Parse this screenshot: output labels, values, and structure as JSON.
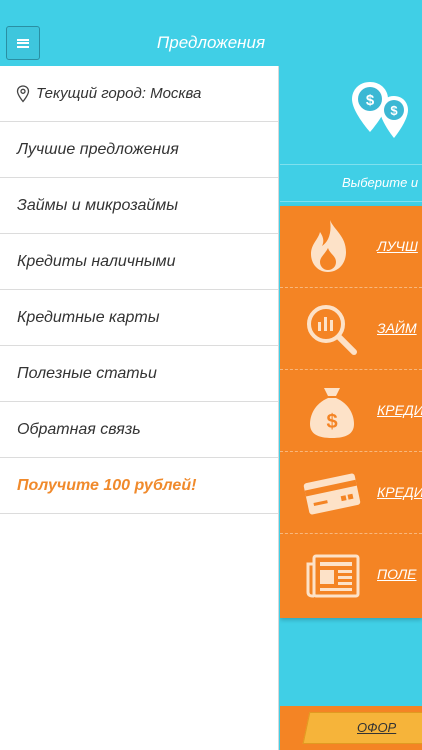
{
  "navbar": {
    "title": "Предложения",
    "menu_icon": "hamburger-icon"
  },
  "drawer": {
    "city_icon": "location-pin-icon",
    "city_label": "Текущий город: Москва",
    "items": [
      {
        "label": "Лучшие предложения"
      },
      {
        "label": "Займы и микрозаймы"
      },
      {
        "label": "Кредиты наличными"
      },
      {
        "label": "Кредитные карты"
      },
      {
        "label": "Полезные статьи"
      },
      {
        "label": "Обратная связь"
      }
    ],
    "promo_label": "Получите 100 рублей!"
  },
  "content": {
    "select_text": "Выберите и",
    "categories": [
      {
        "icon": "fire-icon",
        "label": "ЛУЧШ"
      },
      {
        "icon": "magnifier-chart-icon",
        "label": "ЗАЙМ"
      },
      {
        "icon": "money-bag-icon",
        "label": "КРЕДИ"
      },
      {
        "icon": "credit-card-icon",
        "label": "КРЕДИ"
      },
      {
        "icon": "newspaper-icon",
        "label": "ПОЛЕ"
      }
    ],
    "order_label": "ОФОР"
  },
  "colors": {
    "accent": "#40cfe6",
    "orange": "#f48424",
    "promo": "#f08a2c"
  }
}
